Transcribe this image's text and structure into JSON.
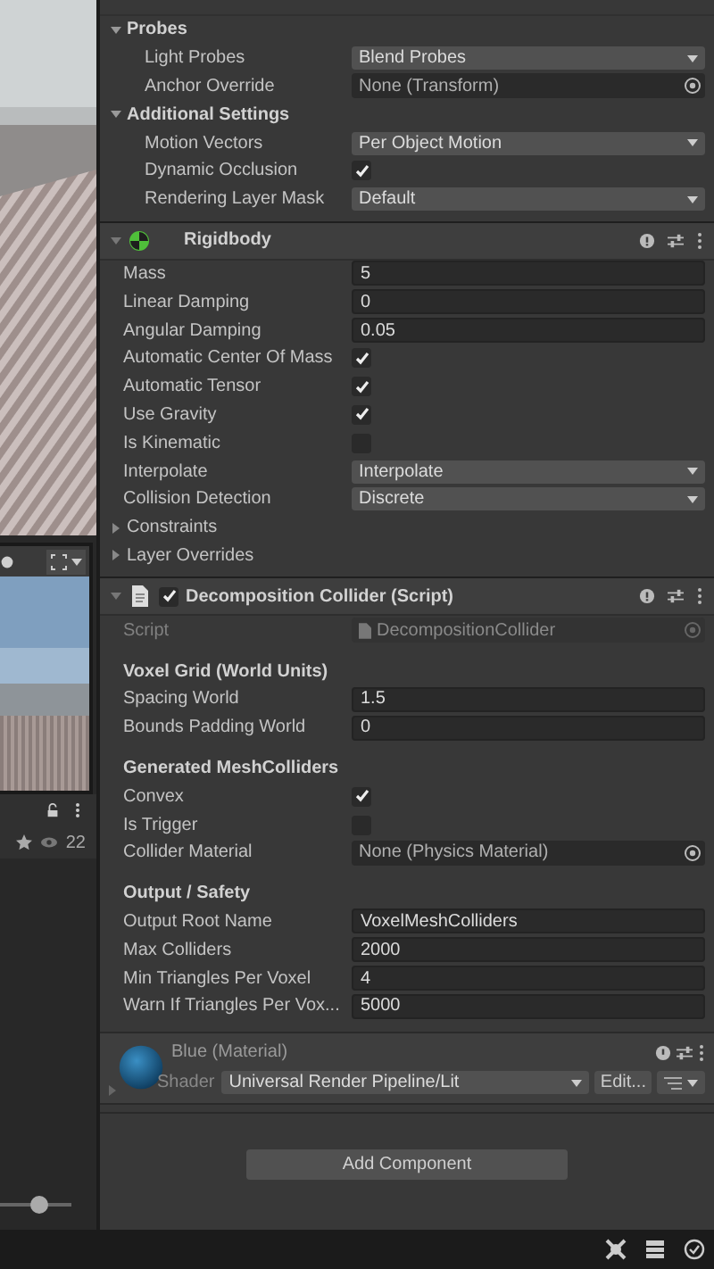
{
  "renderer_rows": [
    {
      "kind": "group",
      "label": "Probes",
      "expanded": true
    },
    {
      "kind": "dropdown",
      "label": "Light Probes",
      "value": "Blend Probes"
    },
    {
      "kind": "object",
      "label": "Anchor Override",
      "value": "None (Transform)"
    },
    {
      "kind": "group",
      "label": "Additional Settings",
      "expanded": true
    },
    {
      "kind": "dropdown",
      "label": "Motion Vectors",
      "value": "Per Object Motion"
    },
    {
      "kind": "toggle",
      "label": "Dynamic Occlusion",
      "checked": true
    },
    {
      "kind": "dropdown",
      "label": "Rendering Layer Mask",
      "value": "Default"
    }
  ],
  "components": [
    {
      "title": "Rigidbody",
      "rows": [
        {
          "kind": "field",
          "label": "Mass",
          "value": "5"
        },
        {
          "kind": "field",
          "label": "Linear Damping",
          "value": "0"
        },
        {
          "kind": "field",
          "label": "Angular Damping",
          "value": "0.05"
        },
        {
          "kind": "toggle",
          "label": "Automatic Center Of Mass",
          "checked": true
        },
        {
          "kind": "toggle",
          "label": "Automatic Tensor",
          "checked": true
        },
        {
          "kind": "toggle",
          "label": "Use Gravity",
          "checked": true
        },
        {
          "kind": "toggle",
          "label": "Is Kinematic",
          "checked": false
        },
        {
          "kind": "dropdown",
          "label": "Interpolate",
          "value": "Interpolate"
        },
        {
          "kind": "dropdown",
          "label": "Collision Detection",
          "value": "Discrete"
        },
        {
          "kind": "foldout",
          "label": "Constraints",
          "expanded": false
        },
        {
          "kind": "foldout",
          "label": "Layer Overrides",
          "expanded": false
        }
      ]
    },
    {
      "title": "Decomposition Collider (Script)",
      "enabled": true,
      "rows": [
        {
          "kind": "script",
          "label": "Script",
          "value": "DecompositionCollider"
        },
        {
          "kind": "heading",
          "label": "Voxel Grid (World Units)"
        },
        {
          "kind": "field",
          "label": "Spacing World",
          "value": "1.5"
        },
        {
          "kind": "field",
          "label": "Bounds Padding World",
          "value": "0"
        },
        {
          "kind": "heading",
          "label": "Generated MeshColliders"
        },
        {
          "kind": "toggle",
          "label": "Convex",
          "checked": true
        },
        {
          "kind": "toggle",
          "label": "Is Trigger",
          "checked": false
        },
        {
          "kind": "object",
          "label": "Collider Material",
          "value": "None (Physics Material)"
        },
        {
          "kind": "heading",
          "label": "Output / Safety"
        },
        {
          "kind": "field",
          "label": "Output Root Name",
          "value": "VoxelMeshColliders"
        },
        {
          "kind": "field",
          "label": "Max Colliders",
          "value": "2000"
        },
        {
          "kind": "field",
          "label": "Min Triangles Per Voxel",
          "value": "4"
        },
        {
          "kind": "field",
          "label": "Warn If Triangles Per Vox...",
          "value": "5000"
        }
      ]
    }
  ],
  "material": {
    "title": "Blue (Material)",
    "shader_label": "Shader",
    "shader": "Universal Render Pipeline/Lit",
    "edit": "Edit..."
  },
  "add_component": "Add Component",
  "game_view": {
    "count": "22",
    "slider": {
      "level": 0.55
    }
  }
}
